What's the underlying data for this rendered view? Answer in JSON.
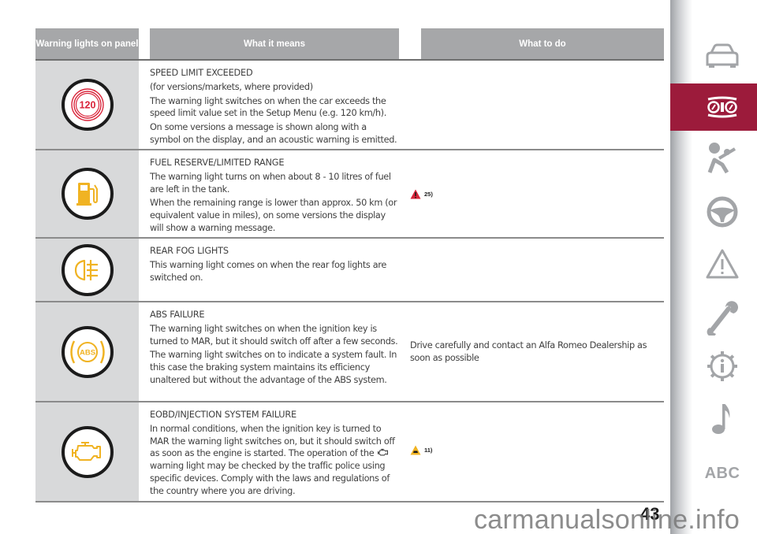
{
  "table": {
    "headers": {
      "col1": "Warning lights on panel",
      "col2": "What it means",
      "col3": "What to do"
    },
    "rows": [
      {
        "icon": "speed-limit-120-icon",
        "icon_text": "120",
        "title": "SPEED LIMIT EXCEEDED",
        "paragraphs": [
          "(for versions/markets, where provided)",
          "The warning light switches on when the car exceeds the speed limit value set in the Setup Menu (e.g. 120 km/h).",
          "On some versions a message is shown along with a symbol on the display, and an acoustic warning is emitted."
        ]
      },
      {
        "icon": "fuel-pump-icon",
        "title": "FUEL RESERVE/LIMITED RANGE",
        "paragraphs": [
          "The warning light turns on when about 8 - 10 litres of fuel are left in the tank.",
          "When the remaining range is lower than approx. 50 km (or equivalent value in miles), on some versions the display will show a warning message."
        ]
      },
      {
        "icon": "rear-fog-light-icon",
        "title": "REAR FOG LIGHTS",
        "paragraphs": [
          "This warning light comes on when the rear fog lights are switched on."
        ]
      },
      {
        "icon": "abs-icon",
        "icon_text": "ABS",
        "title": "ABS FAILURE",
        "paragraphs": [
          "The warning light switches on when the ignition key is turned to MAR, but it should switch off after a few seconds.",
          "The warning light switches on to indicate a system fault. In this case the braking system maintains its efficiency unaltered but without the advantage of the ABS system."
        ]
      },
      {
        "icon": "engine-check-icon",
        "title": "EOBD/INJECTION SYSTEM FAILURE",
        "paragraphs": [
          "In normal conditions, when the ignition key is turned to MAR the warning light switches on, but it should switch off as soon as the engine is started. The operation of the",
          "warning light may be checked by the traffic police using specific devices. Comply with the laws and regulations of the country where you are driving."
        ]
      }
    ],
    "what_to_do": {
      "main_text": "Drive carefully and contact an Alfa Romeo Dealership as soon as possible",
      "refs": [
        {
          "icon": "danger-warning-triangle-icon",
          "label": "25)",
          "color": "#d9243a"
        },
        {
          "icon": "caution-car-triangle-icon",
          "label": "11)",
          "color": "#f0b323"
        }
      ]
    }
  },
  "sidebar": {
    "items": [
      {
        "name": "car-icon",
        "active": false
      },
      {
        "name": "instrument-panel-icon",
        "active": true
      },
      {
        "name": "airbag-safety-icon",
        "active": false
      },
      {
        "name": "steering-wheel-icon",
        "active": false
      },
      {
        "name": "warning-triangle-icon",
        "active": false
      },
      {
        "name": "wrench-icon",
        "active": false
      },
      {
        "name": "gear-info-icon",
        "active": false
      },
      {
        "name": "music-note-icon",
        "active": false
      },
      {
        "name": "abc-index",
        "label": "ABC",
        "active": false
      }
    ],
    "active_color": "#9c1b3b",
    "icon_color": "#a3a5a8"
  },
  "footer": {
    "page_number": "43",
    "watermark": "carmanualsonline.info"
  },
  "colors": {
    "lamp_red": "#d9243a",
    "lamp_amber": "#f0b323",
    "header_gray": "#a6a7a9",
    "icon_cell_gray": "#d8d9da"
  }
}
